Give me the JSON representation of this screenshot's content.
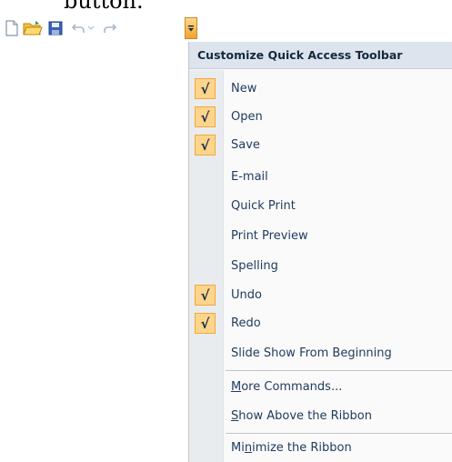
{
  "heading_fragment": "button.",
  "toolbar": {
    "buttons": [
      {
        "name": "new-icon"
      },
      {
        "name": "open-icon"
      },
      {
        "name": "save-icon"
      },
      {
        "name": "undo-icon"
      },
      {
        "name": "redo-icon"
      }
    ],
    "dropdown_icon": "customize-dropdown-icon"
  },
  "menu": {
    "title": "Customize Quick Access Toolbar",
    "check_glyph": "√",
    "items": [
      {
        "label": "New",
        "checked": true
      },
      {
        "label": "Open",
        "checked": true
      },
      {
        "label": "Save",
        "checked": true
      },
      {
        "label": "E-mail",
        "checked": false
      },
      {
        "label": "Quick Print",
        "checked": false
      },
      {
        "label": "Print Preview",
        "checked": false
      },
      {
        "label": "Spelling",
        "checked": false
      },
      {
        "label": "Undo",
        "checked": true
      },
      {
        "label": "Redo",
        "checked": true
      },
      {
        "label": "Slide Show From Beginning",
        "checked": false
      }
    ],
    "more_commands": {
      "prefix": "",
      "accel": "M",
      "rest": "ore Commands..."
    },
    "show_above": {
      "prefix": "",
      "accel": "S",
      "rest": "how Above the Ribbon"
    },
    "minimize": {
      "prefix": "Mi",
      "accel": "n",
      "rest": "imize the Ribbon"
    }
  },
  "colors": {
    "header_bg": "#dde4ee",
    "check_bg": "#fdd58a",
    "check_border": "#f0a83c",
    "label_text": "#1e3a5c"
  }
}
